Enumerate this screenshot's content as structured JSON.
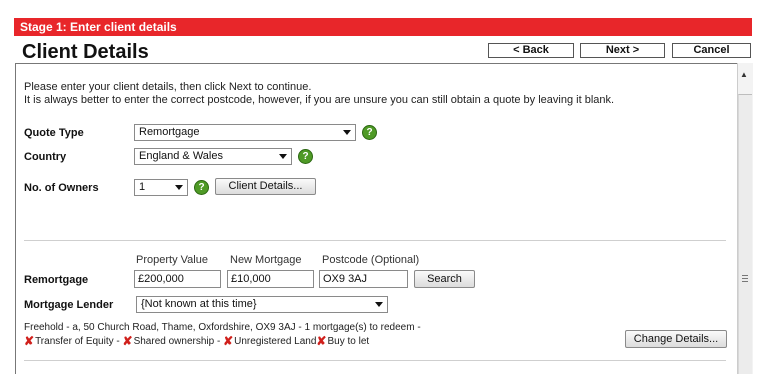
{
  "header": {
    "stage": "Stage 1: Enter client details",
    "title": "Client Details",
    "back_label": "< Back",
    "next_label": "Next >",
    "cancel_label": "Cancel"
  },
  "intro": {
    "line1": "Please enter your client details, then click Next to continue.",
    "line2": "It is always better to enter the correct postcode, however, if you are unsure you can still obtain a quote by leaving it blank."
  },
  "fields": {
    "quote_type": {
      "label": "Quote Type",
      "value": "Remortgage"
    },
    "country": {
      "label": "Country",
      "value": "England & Wales"
    },
    "owners": {
      "label": "No. of Owners",
      "value": "1"
    },
    "client_details_button": "Client Details...",
    "help_glyph": "?"
  },
  "property": {
    "columns": [
      "Property Value",
      "New Mortgage",
      "Postcode (Optional)"
    ],
    "row_label": "Remortgage",
    "property_value": "£200,000",
    "new_mortgage": "£10,000",
    "postcode": "OX9 3AJ",
    "search_label": "Search"
  },
  "lender": {
    "label": "Mortgage Lender",
    "value": "{Not known at this time}"
  },
  "summary": {
    "line1": "Freehold - a, 50 Church Road, Thame, Oxfordshire, OX9 3AJ - 1 mortgage(s) to redeem -",
    "flags": [
      "Transfer of Equity -",
      "Shared ownership -",
      "Unregistered Land",
      "Buy to let"
    ],
    "cross_glyph": "✘",
    "change_label": "Change Details..."
  },
  "colors": {
    "stage_bar": "#e8262a",
    "help_green": "#4f9a26",
    "cross_red": "#d0201c"
  },
  "icons": {
    "help": "help-icon",
    "cross": "cross-icon",
    "dropdown": "chevron-down-icon"
  }
}
